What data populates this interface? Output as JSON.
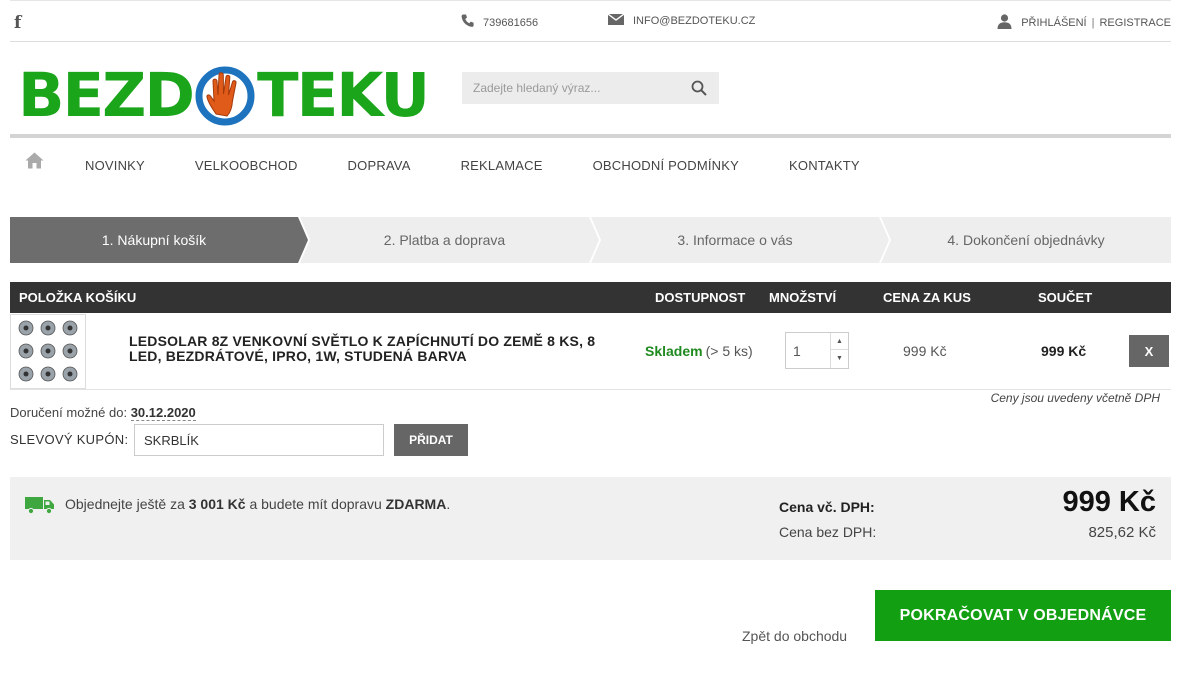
{
  "topbar": {
    "phone": "739681656",
    "email": "INFO@BEZDOTEKU.CZ",
    "login": "PŘIHLÁŠENÍ",
    "separator": "|",
    "register": "REGISTRACE",
    "social_icon": "facebook-icon"
  },
  "logo": {
    "left": "BEZD",
    "right": "TEKU"
  },
  "search": {
    "placeholder": "Zadejte hledaný výraz..."
  },
  "nav": {
    "home_icon": "home-icon",
    "items": [
      "NOVINKY",
      "VELKOOBCHOD",
      "DOPRAVA",
      "REKLAMACE",
      "OBCHODNÍ PODMÍNKY",
      "KONTAKTY"
    ]
  },
  "steps": [
    {
      "label": "1. Nákupní košík",
      "active": true
    },
    {
      "label": "2. Platba a doprava",
      "active": false
    },
    {
      "label": "3. Informace o vás",
      "active": false
    },
    {
      "label": "4. Dokončení objednávky",
      "active": false
    }
  ],
  "table": {
    "headers": {
      "item": "POLOŽKA KOŠÍKU",
      "availability": "DOSTUPNOST",
      "quantity": "MNOŽSTVÍ",
      "unit_price": "CENA ZA KUS",
      "total": "SOUČET"
    },
    "rows": [
      {
        "name": "LEDSOLAR 8Z VENKOVNÍ SVĚTLO K ZAPÍCHNUTÍ DO ZEMĚ 8 KS, 8 LED, BEZDRÁTOVÉ, IPRO, 1W, STUDENÁ BARVA",
        "availability": "Skladem",
        "availability_detail": "(> 5 ks)",
        "quantity": "1",
        "unit_price": "999 Kč",
        "total": "999 Kč",
        "remove": "X"
      }
    ]
  },
  "vat_note": "Ceny jsou uvedeny včetně DPH",
  "delivery": {
    "label": "Doručení možné do:",
    "date": "30.12.2020"
  },
  "coupon": {
    "label": "SLEVOVÝ KUPÓN:",
    "value": "SKRBLÍK",
    "button": "PŘIDAT"
  },
  "summary": {
    "free_shipping_prefix": "Objednejte ještě za",
    "free_shipping_amount": "3 001 Kč",
    "free_shipping_middle": "a budete mít dopravu",
    "free_shipping_word": "ZDARMA",
    "free_shipping_suffix": ".",
    "price_with_vat_label": "Cena vč. DPH:",
    "price_with_vat": "999 Kč",
    "price_without_vat_label": "Cena bez DPH:",
    "price_without_vat": "825,62 Kč"
  },
  "actions": {
    "back": "Zpět do obchodu",
    "continue": "POKRAČOVAT V OBJEDNÁVCE"
  },
  "colors": {
    "brand_green": "#1ba51b",
    "cta_green": "#12a012",
    "dark_header": "#333333",
    "logo_orange": "#e05a1a",
    "logo_blue": "#1e73be"
  }
}
